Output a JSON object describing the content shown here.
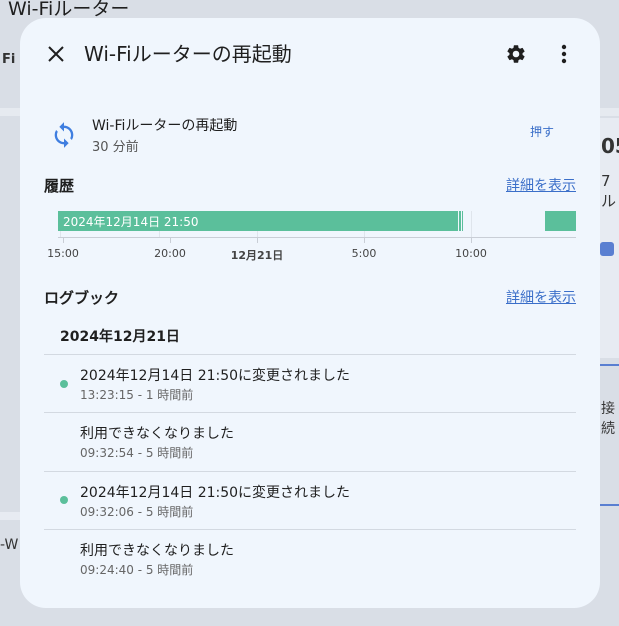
{
  "background": {
    "title": "Wi-Fiルーター",
    "partial_left": "Fi",
    "partial_right_1": "05",
    "partial_right_2": "7ル",
    "partial_right_3": "接続",
    "partial_left_2": "-W"
  },
  "dialog": {
    "title": "Wi-Fiルーターの再起動",
    "close_icon": "close-icon",
    "settings_icon": "gear-icon",
    "more_icon": "more-vert-icon"
  },
  "entity": {
    "icon": "restart-icon",
    "name": "Wi-Fiルーターの再起動",
    "last_changed": "30 分前",
    "action_label": "押す"
  },
  "history": {
    "title": "履歴",
    "details_link": "詳細を表示",
    "bar_label": "2024年12月14日 21:50",
    "axis_labels": [
      "15:00",
      "20:00",
      "12月21日",
      "5:00",
      "10:00"
    ]
  },
  "logbook": {
    "title": "ログブック",
    "details_link": "詳細を表示",
    "date_header": "2024年12月21日",
    "entries": [
      {
        "message": "2024年12月14日 21:50に変更されました",
        "time": "13:23:15 - 1 時間前"
      },
      {
        "message": "利用できなくなりました",
        "time": "09:32:54 - 5 時間前"
      },
      {
        "message": "2024年12月14日 21:50に変更されました",
        "time": "09:32:06 - 5 時間前"
      },
      {
        "message": "利用できなくなりました",
        "time": "09:24:40 - 5 時間前"
      }
    ]
  },
  "colors": {
    "accent": "#3b6fc9",
    "history_bar": "#5bbf9b",
    "dialog_bg": "#f0f6fd"
  }
}
